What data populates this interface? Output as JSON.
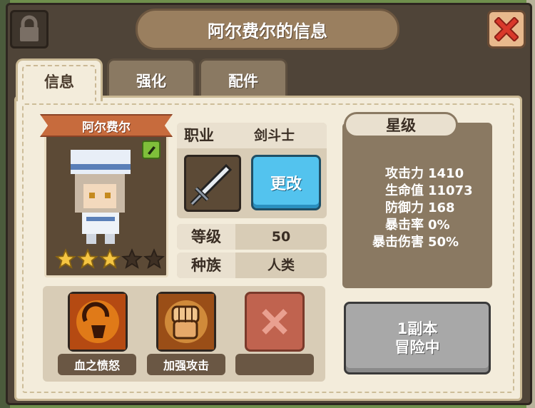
{
  "window": {
    "title": "阿尔费尔的信息"
  },
  "tabs": [
    {
      "label": "信息",
      "active": true
    },
    {
      "label": "强化",
      "active": false
    },
    {
      "label": "配件",
      "active": false
    }
  ],
  "character": {
    "name": "阿尔费尔",
    "stars_filled": 3,
    "stars_total": 5
  },
  "job": {
    "label": "职业",
    "value": "剑斗士",
    "change_label": "更改"
  },
  "level": {
    "label": "等级",
    "value": "50"
  },
  "race": {
    "label": "种族",
    "value": "人类"
  },
  "skills": [
    {
      "label": "血之愤怒",
      "icon": "ram-skull-icon"
    },
    {
      "label": "加强攻击",
      "icon": "fist-icon"
    },
    {
      "label": "",
      "icon": "empty-slot-x-icon"
    }
  ],
  "grade": {
    "title": "星级",
    "stats": [
      {
        "name": "攻击力",
        "value": "1410"
      },
      {
        "name": "生命值",
        "value": "11073"
      },
      {
        "name": "防御力",
        "value": "168"
      },
      {
        "name": "暴击率",
        "value": "0%"
      },
      {
        "name": "暴击伤害",
        "value": "50%"
      }
    ]
  },
  "dungeon_button": {
    "line1": "1副本",
    "line2": "冒险中"
  },
  "colors": {
    "frame": "#4f4438",
    "panel": "#f3ecdb",
    "change_button": "#53c3ee",
    "close_button": "#e8b98d",
    "close_x": "#c0392b",
    "star_filled": "#f5c542"
  }
}
